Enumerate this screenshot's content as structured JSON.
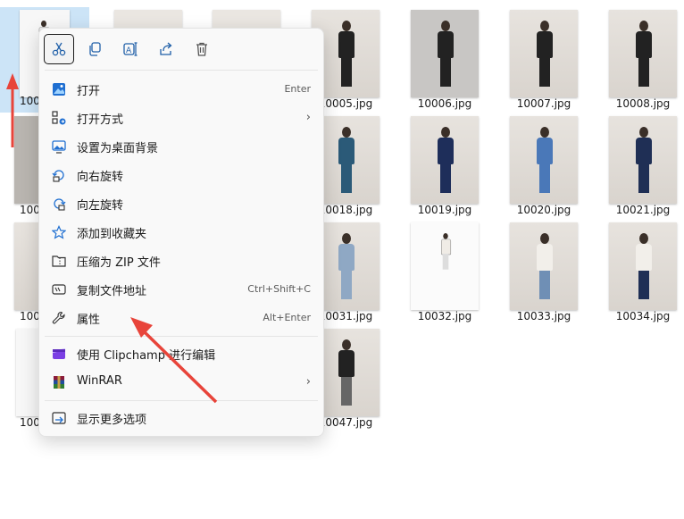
{
  "files": {
    "row1": [
      "10005.jpg",
      "10006.jpg",
      "10007.jpg",
      "10008.jpg"
    ],
    "row2": [
      "10018.jpg",
      "10019.jpg",
      "10020.jpg",
      "10021.jpg"
    ],
    "row3": [
      "10031.jpg",
      "10032.jpg",
      "10033.jpg",
      "10034.jpg"
    ],
    "row4": [
      "10047.jpg"
    ],
    "left_partial": [
      "100",
      "100",
      "100",
      "100"
    ]
  },
  "menu": {
    "icons": [
      "cut-icon",
      "copy-icon",
      "rename-icon",
      "share-icon",
      "delete-icon"
    ],
    "items": [
      {
        "label": "打开",
        "shortcut": "Enter",
        "icon": "photos-icon"
      },
      {
        "label": "打开方式",
        "chevron": "›",
        "icon": "open-with-icon"
      },
      {
        "label": "设置为桌面背景",
        "icon": "wallpaper-icon"
      },
      {
        "label": "向右旋转",
        "icon": "rotate-right-icon"
      },
      {
        "label": "向左旋转",
        "icon": "rotate-left-icon"
      },
      {
        "label": "添加到收藏夹",
        "icon": "star-icon"
      },
      {
        "label": "压缩为 ZIP 文件",
        "icon": "zip-folder-icon"
      },
      {
        "label": "复制文件地址",
        "shortcut": "Ctrl+Shift+C",
        "icon": "copy-path-icon"
      },
      {
        "label": "属性",
        "shortcut": "Alt+Enter",
        "icon": "wrench-icon"
      },
      {
        "label": "使用 Clipchamp 进行编辑",
        "icon": "clipchamp-icon"
      },
      {
        "label": "WinRAR",
        "chevron": "›",
        "icon": "winrar-icon"
      },
      {
        "label": "显示更多选项",
        "icon": "more-options-icon"
      }
    ]
  },
  "colors": {
    "accent": "#e8443a",
    "selection": "#cce4f7"
  }
}
